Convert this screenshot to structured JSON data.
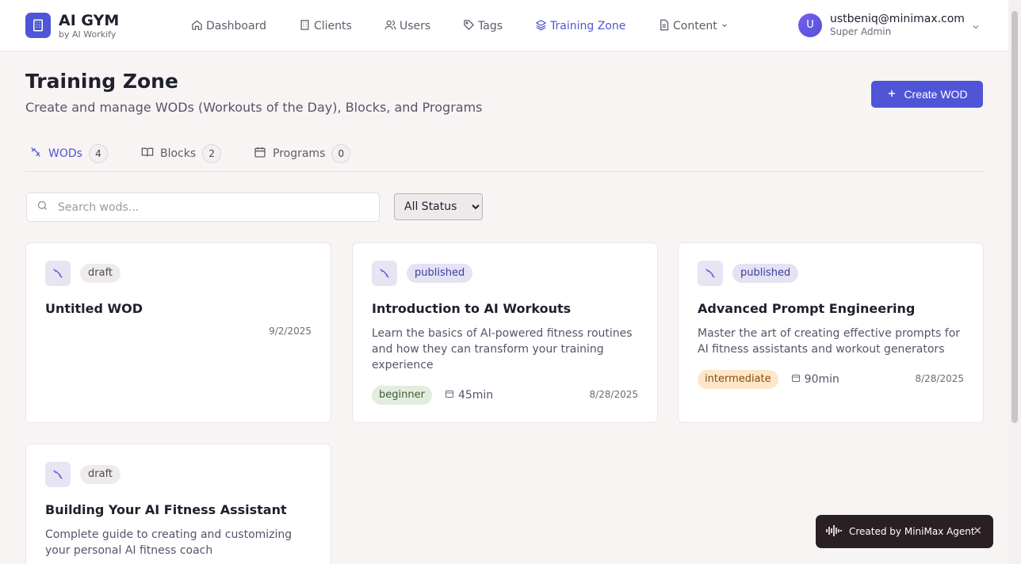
{
  "app": {
    "name": "AI GYM",
    "tagline": "by AI Workify"
  },
  "nav": {
    "items": [
      {
        "label": "Dashboard",
        "icon": "home-icon"
      },
      {
        "label": "Clients",
        "icon": "building-icon"
      },
      {
        "label": "Users",
        "icon": "users-icon"
      },
      {
        "label": "Tags",
        "icon": "tag-icon"
      },
      {
        "label": "Training Zone",
        "icon": "layers-icon",
        "active": true
      },
      {
        "label": "Content",
        "icon": "document-icon"
      }
    ]
  },
  "user": {
    "initial": "U",
    "email": "ustbeniq@minimax.com",
    "role": "Super Admin"
  },
  "page": {
    "title": "Training Zone",
    "subtitle": "Create and manage WODs (Workouts of the Day), Blocks, and Programs",
    "create_label": "Create WOD"
  },
  "tabs": [
    {
      "label": "WODs",
      "count": "4",
      "icon": "dumbbell-icon",
      "active": true
    },
    {
      "label": "Blocks",
      "count": "2",
      "icon": "book-icon"
    },
    {
      "label": "Programs",
      "count": "0",
      "icon": "calendar-icon"
    }
  ],
  "filters": {
    "search_placeholder": "Search wods...",
    "search_value": "",
    "status_selected": "All Status"
  },
  "cards": [
    {
      "status": "draft",
      "title": "Untitled WOD",
      "description": "",
      "level": "",
      "duration": "",
      "date": "9/2/2025"
    },
    {
      "status": "published",
      "title": "Introduction to AI Workouts",
      "description": "Learn the basics of AI-powered fitness routines and how they can transform your training experience",
      "level": "beginner",
      "duration": "45min",
      "date": "8/28/2025"
    },
    {
      "status": "published",
      "title": "Advanced Prompt Engineering",
      "description": "Master the art of creating effective prompts for AI fitness assistants and workout generators",
      "level": "intermediate",
      "duration": "90min",
      "date": "8/28/2025"
    },
    {
      "status": "draft",
      "title": "Building Your AI Fitness Assistant",
      "description": "Complete guide to creating and customizing your personal AI fitness coach",
      "level": "",
      "duration": "",
      "date": ""
    }
  ],
  "toast": {
    "text": "Created by MiniMax Agent",
    "close": "×"
  },
  "colors": {
    "accent": "#4f55d6",
    "background": "#f8f4f4",
    "toast_bg": "#2a1f24"
  }
}
